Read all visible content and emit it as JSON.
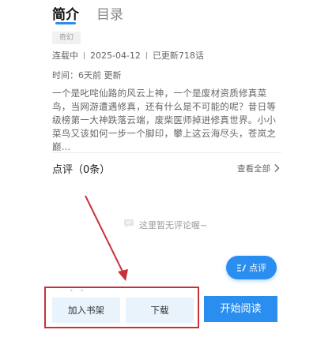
{
  "tabs": {
    "intro": "简介",
    "toc": "目录"
  },
  "book": {
    "genre": "奇幻",
    "status": "连载中",
    "date": "2025-04-12",
    "chapters": "已更新718话",
    "updated": "时间：6天前 更新",
    "synopsis": "一个是叱咤仙路的风云上神，一个是废材资质修真菜鸟，当网游遭遇修真，还有什么是不可能的呢？昔日等级榜第一大神跌落云端，废柴医师掉进修真世界。小小菜鸟又该如何一步一个脚印，攀上这云海尽头，苍岚之巅…"
  },
  "comments": {
    "title": "点评（0条）",
    "view_all": "查看全部",
    "empty": "这里暂无评论喔~",
    "fab_label": "点评"
  },
  "actions": {
    "shelf": "加入书架",
    "download": "下载",
    "read": "开始阅读"
  },
  "colors": {
    "accent": "#2a8ef0",
    "annotation": "#c8313a"
  }
}
